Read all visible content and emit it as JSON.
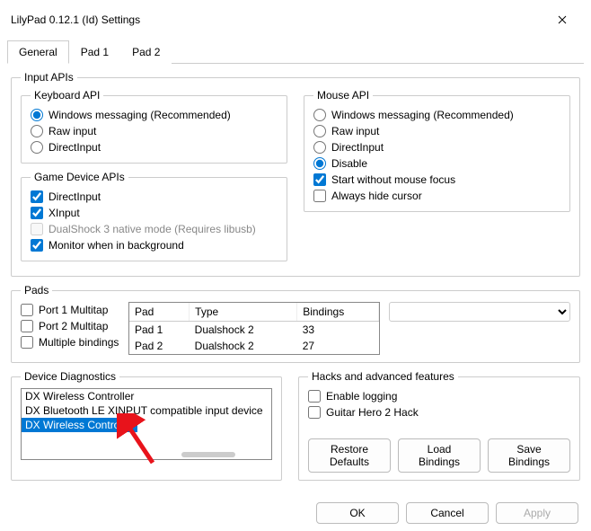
{
  "window": {
    "title": "LilyPad 0.12.1 (Id) Settings"
  },
  "tabs": [
    "General",
    "Pad 1",
    "Pad 2"
  ],
  "input_apis": {
    "legend": "Input APIs",
    "keyboard": {
      "legend": "Keyboard API",
      "options": [
        "Windows messaging (Recommended)",
        "Raw input",
        "DirectInput"
      ],
      "selected": 0
    },
    "game_device": {
      "legend": "Game Device APIs",
      "directinput": "DirectInput",
      "xinput": "XInput",
      "dualshock3": "DualShock 3 native mode (Requires libusb)",
      "monitor_bg": "Monitor when in background"
    },
    "mouse": {
      "legend": "Mouse API",
      "options": [
        "Windows messaging (Recommended)",
        "Raw input",
        "DirectInput",
        "Disable"
      ],
      "selected": 3,
      "start_without_focus": "Start without mouse focus",
      "always_hide": "Always hide cursor"
    }
  },
  "pads": {
    "legend": "Pads",
    "port1": "Port 1 Multitap",
    "port2": "Port 2 Multitap",
    "multiple": "Multiple bindings",
    "headers": [
      "Pad",
      "Type",
      "Bindings"
    ],
    "rows": [
      {
        "pad": "Pad 1",
        "type": "Dualshock 2",
        "bindings": "33"
      },
      {
        "pad": "Pad 2",
        "type": "Dualshock 2",
        "bindings": "27"
      }
    ]
  },
  "diagnostics": {
    "legend": "Device Diagnostics",
    "items": [
      "DX Wireless Controller",
      "DX Bluetooth LE XINPUT compatible input device",
      "DX Wireless Controller"
    ],
    "selected": 2
  },
  "hacks": {
    "legend": "Hacks and advanced features",
    "enable_logging": "Enable logging",
    "gh2": "Guitar Hero 2 Hack",
    "restore": "Restore Defaults",
    "load": "Load Bindings",
    "save": "Save Bindings"
  },
  "dialog": {
    "ok": "OK",
    "cancel": "Cancel",
    "apply": "Apply"
  }
}
